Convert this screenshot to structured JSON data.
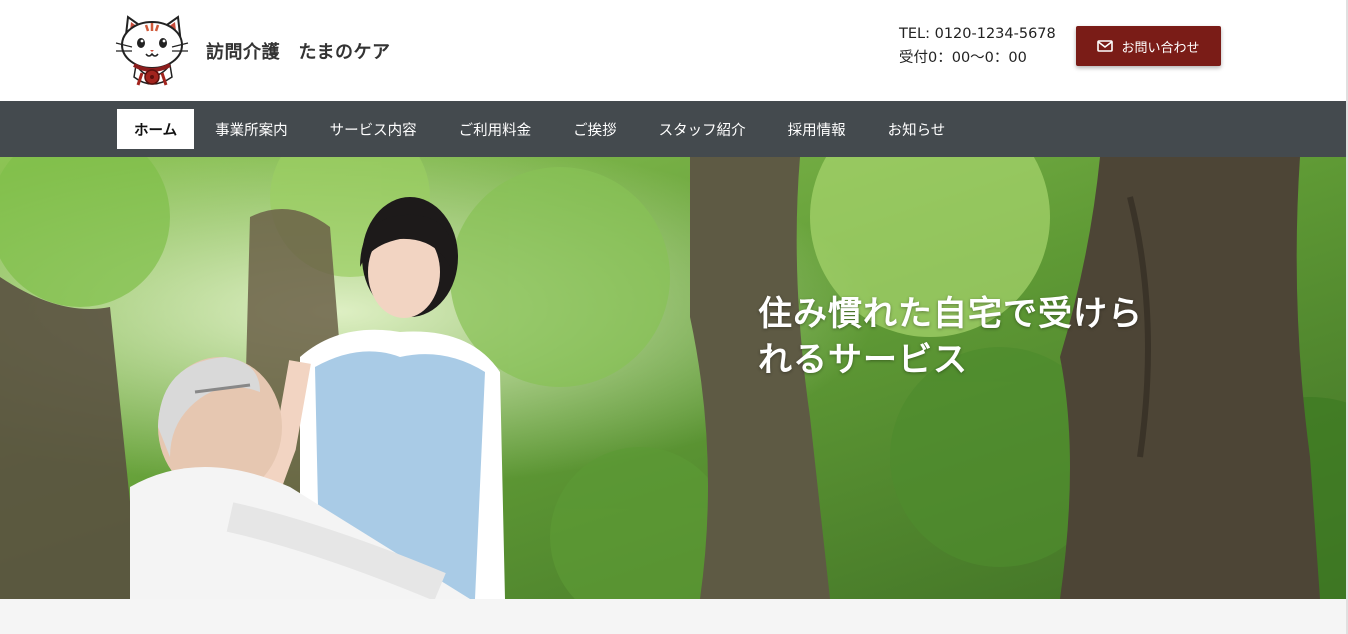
{
  "header": {
    "site_title": "訪問介護　たまのケア",
    "logo_icon": "cat-mascot-icon",
    "tel": "TEL: 0120-1234-5678",
    "hours": "受付0：00〜0：00",
    "inquiry_label": "お問い合わせ",
    "inquiry_icon": "mail-icon"
  },
  "nav": {
    "items": [
      {
        "label": "ホーム",
        "active": true
      },
      {
        "label": "事業所案内"
      },
      {
        "label": "サービス内容"
      },
      {
        "label": "ご利用料金"
      },
      {
        "label": "ご挨拶"
      },
      {
        "label": "スタッフ紹介"
      },
      {
        "label": "採用情報"
      },
      {
        "label": "お知らせ"
      }
    ]
  },
  "hero": {
    "caption_line1": "住み慣れた自宅で受けら",
    "caption_line2": "れるサービス"
  },
  "colors": {
    "brand": "#7a1c17",
    "nav_bg": "#444a4e",
    "hero_green": "#6fa83e"
  }
}
